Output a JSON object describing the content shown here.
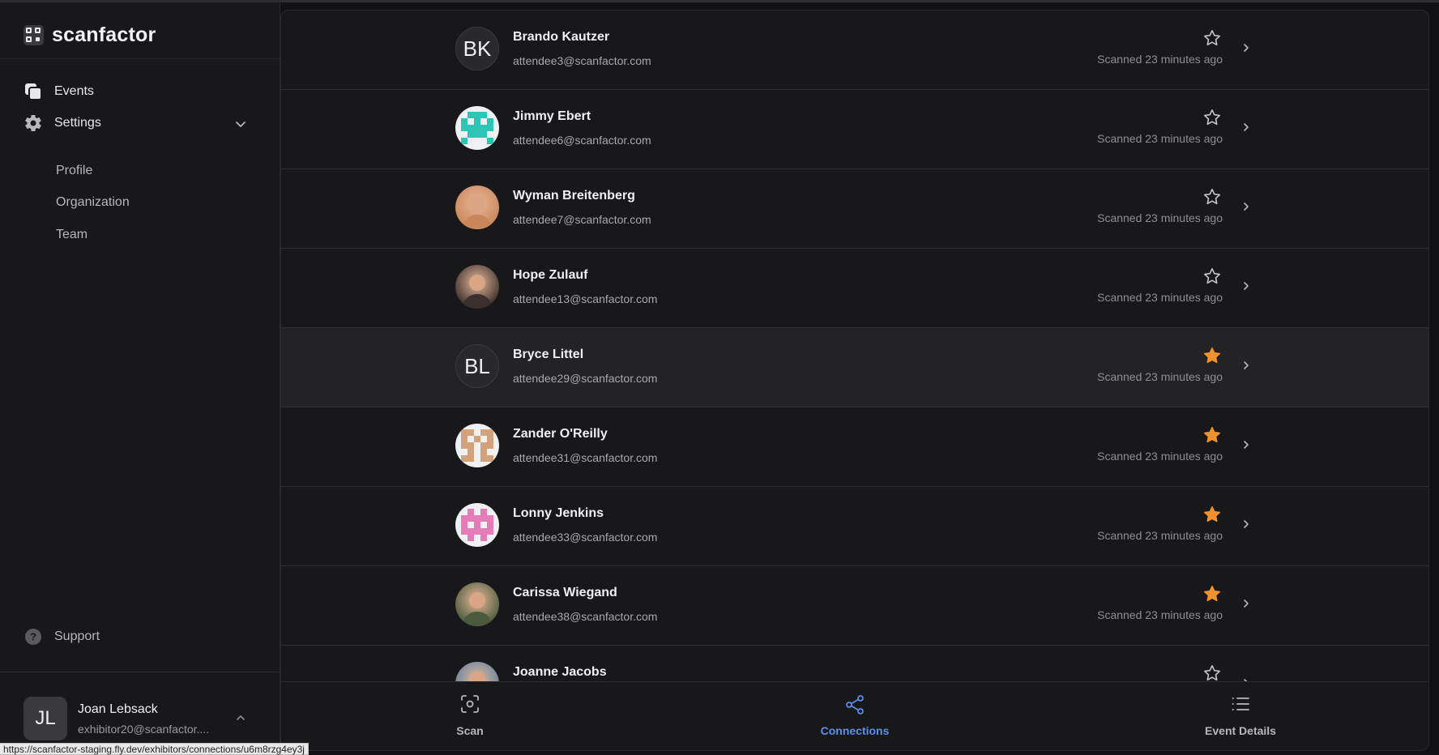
{
  "app": {
    "name": "scanfactor"
  },
  "sidebar": {
    "nav": [
      {
        "label": "Events",
        "icon": "events-icon"
      },
      {
        "label": "Settings",
        "icon": "gear-icon"
      }
    ],
    "settings_sub": [
      "Profile",
      "Organization",
      "Team"
    ],
    "support": {
      "label": "Support",
      "icon": "question-icon"
    },
    "user": {
      "initials": "JL",
      "name": "Joan Lebsack",
      "email": "exhibitor20@scanfactor...."
    }
  },
  "connections": [
    {
      "name": "Brando Kautzer",
      "email": "attendee3@scanfactor.com",
      "scanned": "Scanned 23 minutes ago",
      "starred": false,
      "avatar": "initials",
      "initials": "BK"
    },
    {
      "name": "Jimmy Ebert",
      "email": "attendee6@scanfactor.com",
      "scanned": "Scanned 23 minutes ago",
      "starred": false,
      "avatar": "identicon-teal"
    },
    {
      "name": "Wyman Breitenberg",
      "email": "attendee7@scanfactor.com",
      "scanned": "Scanned 23 minutes ago",
      "starred": false,
      "avatar": "photo"
    },
    {
      "name": "Hope Zulauf",
      "email": "attendee13@scanfactor.com",
      "scanned": "Scanned 23 minutes ago",
      "starred": false,
      "avatar": "photo"
    },
    {
      "name": "Bryce Littel",
      "email": "attendee29@scanfactor.com",
      "scanned": "Scanned 23 minutes ago",
      "starred": true,
      "avatar": "initials",
      "initials": "BL"
    },
    {
      "name": "Zander O'Reilly",
      "email": "attendee31@scanfactor.com",
      "scanned": "Scanned 23 minutes ago",
      "starred": true,
      "avatar": "identicon-tan"
    },
    {
      "name": "Lonny Jenkins",
      "email": "attendee33@scanfactor.com",
      "scanned": "Scanned 23 minutes ago",
      "starred": true,
      "avatar": "identicon-pink"
    },
    {
      "name": "Carissa Wiegand",
      "email": "attendee38@scanfactor.com",
      "scanned": "Scanned 23 minutes ago",
      "starred": true,
      "avatar": "photo"
    },
    {
      "name": "Joanne Jacobs",
      "email": "",
      "scanned": "",
      "starred": false,
      "avatar": "photo"
    }
  ],
  "tabs": [
    {
      "label": "Scan",
      "icon": "scan-icon",
      "active": false
    },
    {
      "label": "Connections",
      "icon": "share-icon",
      "active": true
    },
    {
      "label": "Event Details",
      "icon": "list-icon",
      "active": false
    }
  ],
  "status_url": "https://scanfactor-staging.fly.dev/exhibitors/connections/u6m8rzg4ey3j",
  "colors": {
    "accent": "#5b8fe8",
    "star": "#f0922e",
    "background": "#18181b"
  }
}
